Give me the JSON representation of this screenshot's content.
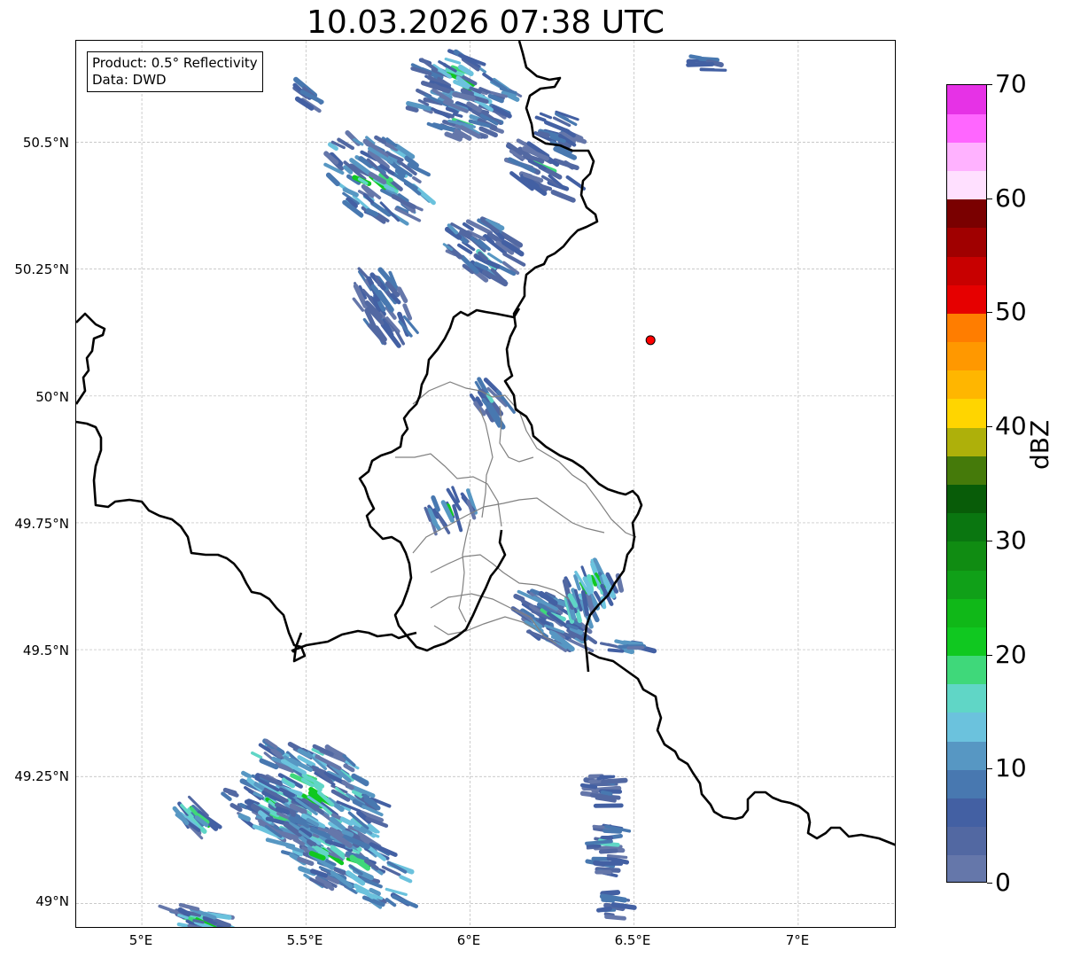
{
  "title": "10.03.2026 07:38 UTC",
  "info": {
    "product_line": "Product: 0.5° Reflectivity",
    "data_line": "Data: DWD"
  },
  "axes": {
    "lat_labels": [
      "50.5°N",
      "50.25°N",
      "50°N",
      "49.75°N",
      "49.5°N",
      "49.25°N",
      "49°N"
    ],
    "lon_labels": [
      "5°E",
      "5.5°E",
      "6°E",
      "6.5°E",
      "7°E"
    ],
    "lat_range": [
      48.95,
      50.7
    ],
    "lon_range": [
      4.8,
      7.3
    ],
    "grid": true
  },
  "colorbar": {
    "unit": "dBZ",
    "tick_labels": [
      "0",
      "10",
      "20",
      "30",
      "40",
      "50",
      "60",
      "70"
    ],
    "range": [
      0,
      70
    ],
    "colors": [
      "#6577aa",
      "#5268a2",
      "#4360a3",
      "#4878b0",
      "#5797c3",
      "#6bc2dd",
      "#60d6c6",
      "#3fd87a",
      "#10c820",
      "#10b818",
      "#10a018",
      "#108c12",
      "#0a7610",
      "#085c08",
      "#457a0a",
      "#aeb00a",
      "#ffd500",
      "#ffb600",
      "#ff9800",
      "#ff7d00",
      "#e60000",
      "#c80000",
      "#a00000",
      "#7a0000",
      "#ffe0ff",
      "#ffb2ff",
      "#ff66ff",
      "#e632e6"
    ]
  },
  "radar_site": {
    "lat": 50.11,
    "lon": 6.55,
    "color": "#ff0000"
  }
}
